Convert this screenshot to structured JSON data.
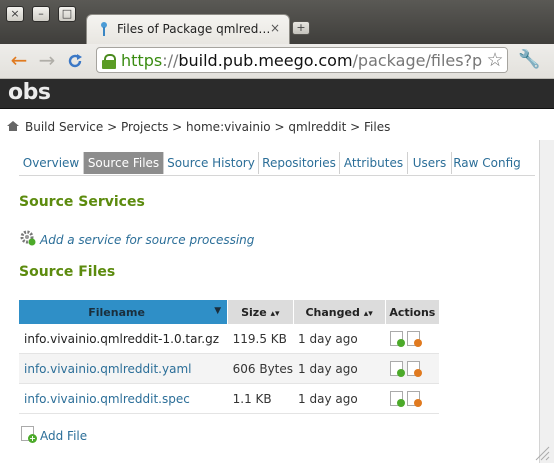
{
  "browser": {
    "tab_title": "Files of Package qmlred…",
    "tab_close": "×",
    "new_tab": "+",
    "url_scheme": "https",
    "url_sep": "://",
    "url_host": "build.pub.meego.com",
    "url_path": "/package/files?package",
    "window_buttons": [
      "×",
      "–",
      "□"
    ]
  },
  "site": {
    "logo": "obs"
  },
  "breadcrumb": {
    "items": [
      "Build Service",
      "Projects",
      "home:vivainio",
      "qmlreddit",
      "Files"
    ],
    "separator": ">"
  },
  "tabs": [
    {
      "label": "Overview",
      "active": false
    },
    {
      "label": "Source Files",
      "active": true
    },
    {
      "label": "Source History",
      "active": false
    },
    {
      "label": "Repositories",
      "active": false
    },
    {
      "label": "Attributes",
      "active": false
    },
    {
      "label": "Users",
      "active": false
    },
    {
      "label": "Raw Config",
      "active": false
    }
  ],
  "source_services": {
    "heading": "Source Services",
    "add_link": "Add a service for source processing"
  },
  "source_files": {
    "heading": "Source Files",
    "columns": {
      "filename": "Filename",
      "size": "Size",
      "changed": "Changed",
      "actions": "Actions"
    },
    "rows": [
      {
        "name": "info.vivainio.qmlreddit-1.0.tar.gz",
        "size": "119.5 KB",
        "changed": "1 day ago"
      },
      {
        "name": "info.vivainio.qmlreddit.yaml",
        "size": "606 Bytes",
        "changed": "1 day ago"
      },
      {
        "name": "info.vivainio.qmlreddit.spec",
        "size": "1.1 KB",
        "changed": "1 day ago"
      }
    ],
    "add_file": "Add File"
  },
  "colors": {
    "accent_green": "#5c8b0e",
    "link_blue": "#2b6e98",
    "sorted_header": "#2f8fc7",
    "active_tab": "#8d8d8d"
  }
}
